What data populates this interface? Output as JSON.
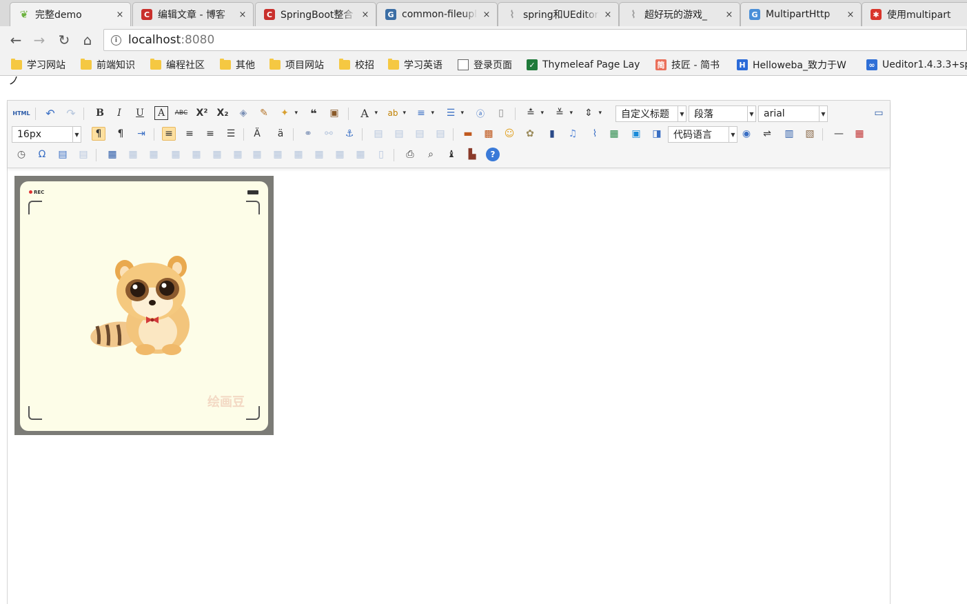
{
  "tabs": [
    {
      "title": "完整demo",
      "icon": "spring-leaf-icon",
      "color": "#6db33f",
      "active": true
    },
    {
      "title": "编辑文章 - 博客",
      "icon": "csdn-icon",
      "color": "#c9302c"
    },
    {
      "title": "SpringBoot整合",
      "icon": "csdn-icon",
      "color": "#c9302c"
    },
    {
      "title": "common-fileupload",
      "icon": "cnblogs-icon",
      "color": "#3b6ea5"
    },
    {
      "title": "spring和UEditor",
      "icon": "loading-antenna-icon",
      "color": "#999999"
    },
    {
      "title": "超好玩的游戏_",
      "icon": "loading-antenna-icon",
      "color": "#999999"
    },
    {
      "title": "MultipartHttp",
      "icon": "cnblogs-icon",
      "color": "#4a8fd8"
    },
    {
      "title": "使用multipart",
      "icon": "colorful-logo-icon",
      "color": "#d9352b"
    }
  ],
  "tab_close": "×",
  "address": {
    "host": "localhost",
    "port": ":8080",
    "info_glyph": "i"
  },
  "bookmarks": [
    {
      "label": "学习网站",
      "type": "folder"
    },
    {
      "label": "前端知识",
      "type": "folder"
    },
    {
      "label": "编程社区",
      "type": "folder"
    },
    {
      "label": "其他",
      "type": "folder"
    },
    {
      "label": "项目网站",
      "type": "folder"
    },
    {
      "label": "校招",
      "type": "folder"
    },
    {
      "label": "学习英语",
      "type": "folder"
    },
    {
      "label": "登录页面",
      "type": "page"
    },
    {
      "label": "Thymeleaf Page Lay",
      "type": "site",
      "color": "#1f7a3a",
      "glyph": "✓"
    },
    {
      "label": "技匠 - 简书",
      "type": "site",
      "color": "#ea6f5a",
      "glyph": "简"
    },
    {
      "label": "Helloweba_致力于W",
      "type": "site",
      "color": "#2a6ad8",
      "glyph": "H"
    },
    {
      "label": "Ueditor1.4.3.3+sp",
      "type": "site",
      "color": "#2f6fd6",
      "glyph": "∞"
    }
  ],
  "editor": {
    "font_size": "16px",
    "custom_heading": "自定义标题",
    "paragraph": "段落",
    "font_family": "arial",
    "code_language": "代码语言",
    "html_label": "HTML",
    "image": {
      "rec_label": "REC",
      "watermark": "绘画豆"
    }
  }
}
